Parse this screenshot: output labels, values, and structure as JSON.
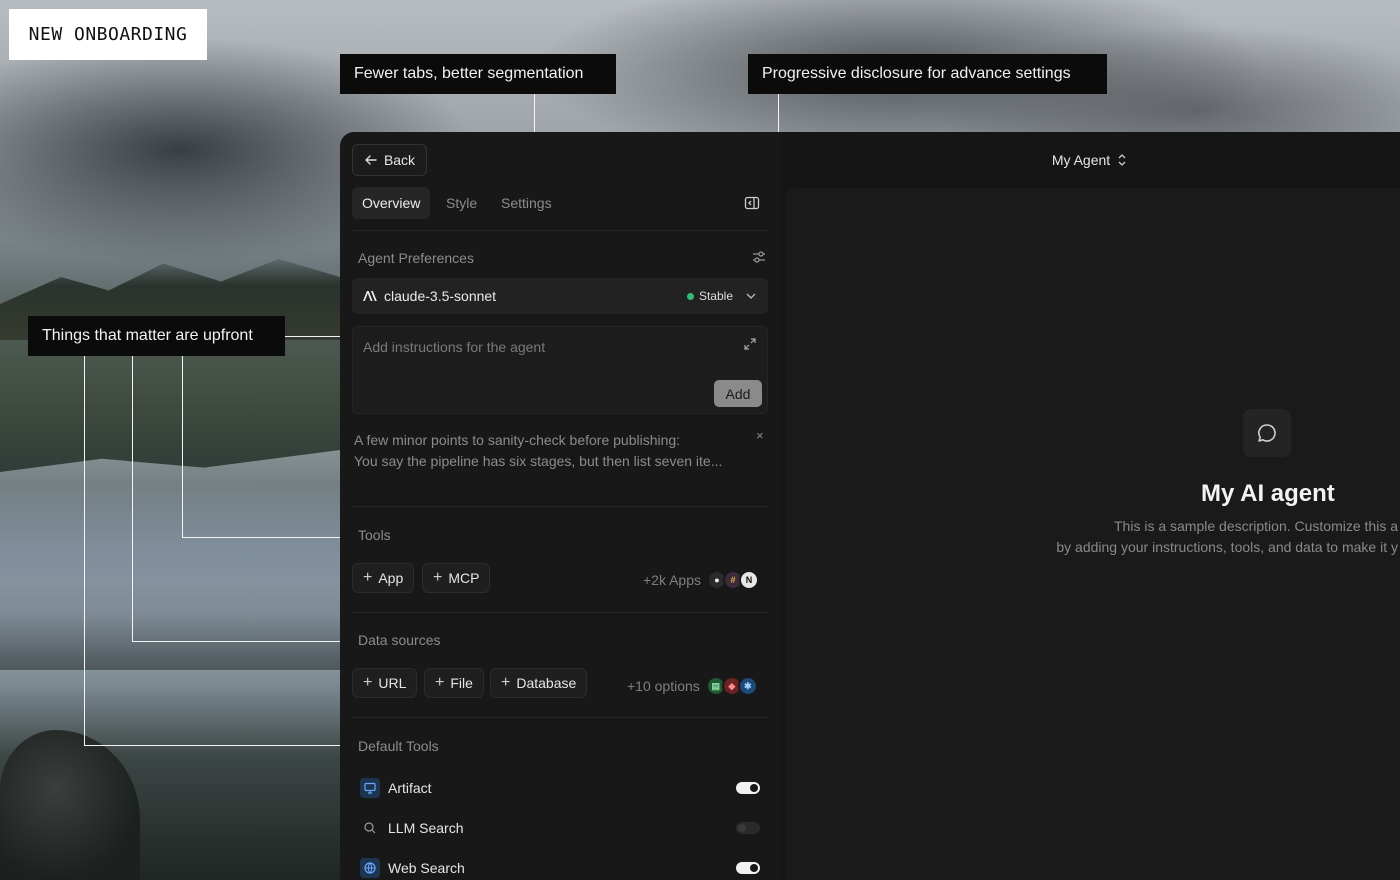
{
  "brand_tag": "NEW ONBOARDING",
  "callouts": {
    "tabs": "Fewer tabs, better segmentation",
    "disclosure": "Progressive disclosure for advance settings",
    "upfront": "Things that matter are upfront"
  },
  "panel": {
    "back_label": "Back",
    "tabs": [
      {
        "label": "Overview",
        "active": true
      },
      {
        "label": "Style",
        "active": false
      },
      {
        "label": "Settings",
        "active": false
      }
    ],
    "preferences_title": "Agent Preferences",
    "model": {
      "name": "claude-3.5-sonnet",
      "status": "Stable",
      "status_color": "#2fbf71"
    },
    "instructions": {
      "placeholder": "Add instructions for the agent",
      "add_label": "Add"
    },
    "note": {
      "line1": "A few minor points to sanity-check before publishing:",
      "line2": "You say the pipeline has six stages, but then list seven ite...",
      "close": "×"
    },
    "tools": {
      "title": "Tools",
      "app_label": "App",
      "mcp_label": "MCP",
      "more": "+2k Apps",
      "logos": [
        "github-icon",
        "slack-icon",
        "notion-icon"
      ]
    },
    "data_sources": {
      "title": "Data sources",
      "url_label": "URL",
      "file_label": "File",
      "database_label": "Database",
      "more": "+10 options",
      "logos": [
        "sheets-icon",
        "db-icon",
        "snowflake-icon"
      ]
    },
    "default_tools": {
      "title": "Default Tools",
      "items": [
        {
          "label": "Artifact",
          "icon": "monitor-icon",
          "enabled": true
        },
        {
          "label": "LLM Search",
          "icon": "search-icon",
          "enabled": false
        },
        {
          "label": "Web Search",
          "icon": "globe-icon",
          "enabled": true
        }
      ]
    }
  },
  "stage": {
    "agent_switcher": "My Agent",
    "title": "My AI agent",
    "desc_line1": "This is a sample description. Customize this a",
    "desc_line2": "by adding your instructions, tools, and data to make it y"
  },
  "colors": {
    "accent_blue": "#3b7bd6",
    "panel_bg": "#181818",
    "status_green": "#2fbf71"
  }
}
